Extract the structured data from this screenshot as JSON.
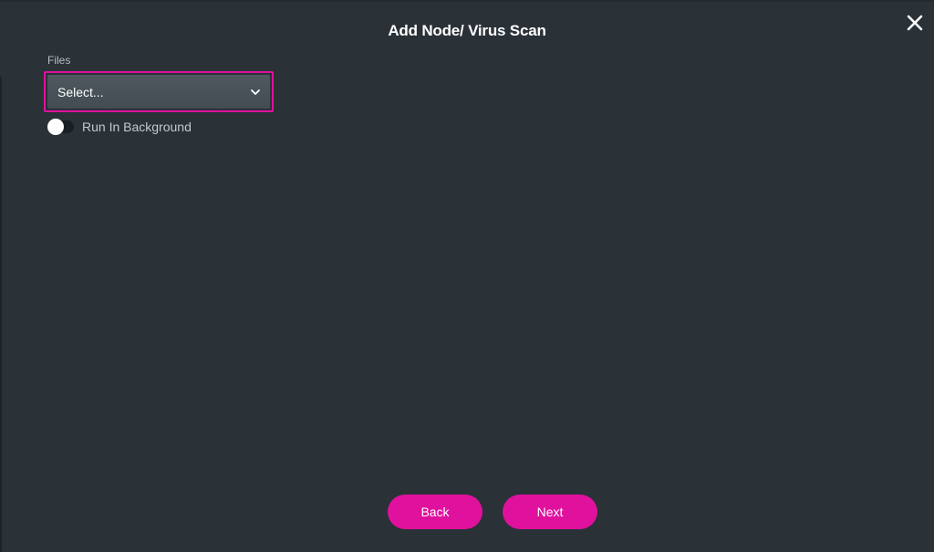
{
  "dialog": {
    "title": "Add Node/ Virus Scan"
  },
  "fields": {
    "files": {
      "label": "Files",
      "value": "Select..."
    },
    "run_in_background": {
      "label": "Run In Background",
      "enabled": false
    }
  },
  "buttons": {
    "back_label": "Back",
    "next_label": "Next"
  },
  "icons": {
    "close": "close-icon",
    "dropdown": "chevron-down-icon"
  },
  "colors": {
    "accent": "#e0119d",
    "background": "#2a3137"
  }
}
